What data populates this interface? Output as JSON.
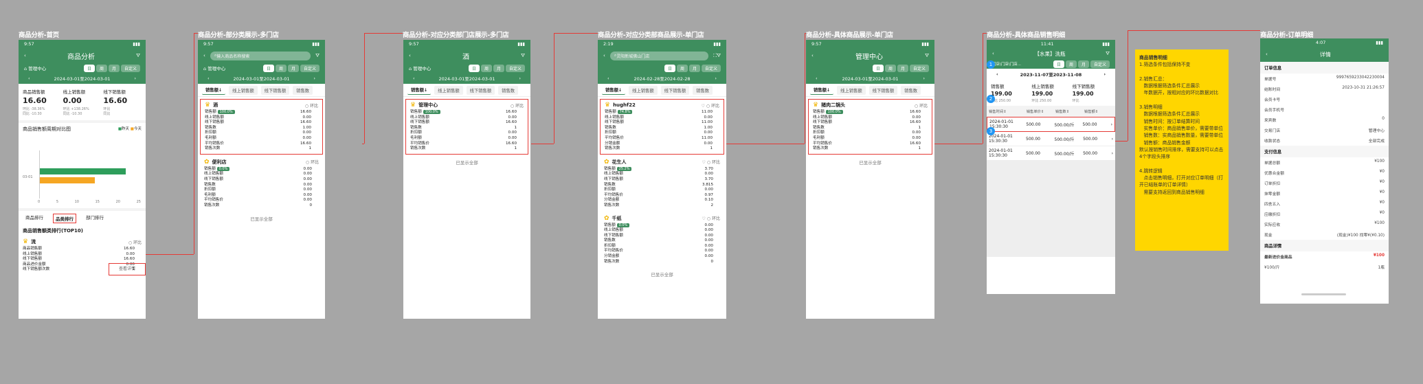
{
  "colors": {
    "brand": "#3e8e5e",
    "highlight": "#e53935",
    "note_bg": "#ffd600",
    "bar_green": "#2e9e5b",
    "bar_orange": "#f5a623"
  },
  "titles": [
    "商品分析-首页",
    "商品分析-部分类展示-多门店",
    "商品分析-对应分类部门店展示-多门店",
    "商品分析-对应分类部商品展示-单门店",
    "商品分析-具体商品展示-单门店",
    "商品分析-具体商品销售明细",
    "商品分析-订单明细"
  ],
  "s1": {
    "time": "9:57",
    "title": "商品分析",
    "store": "管理中心",
    "seg": [
      "日",
      "周",
      "月",
      "自定义"
    ],
    "range": "2024-03-01至2024-03-01",
    "kpis": [
      {
        "label": "商品销售额",
        "value": "16.60",
        "c1": "环比 -38.36%",
        "c2": "同比 -10.30"
      },
      {
        "label": "线上销售额",
        "value": "0.00",
        "c1": "环比 +138.26%",
        "c2": "同比 -10.30"
      },
      {
        "label": "线下销售额",
        "value": "16.60",
        "c1": "环比",
        "c2": "同比"
      }
    ],
    "chart_title": "商品销售额周期对比图",
    "legend": [
      "昨天",
      "今天"
    ],
    "ycat": "03-01",
    "xt": [
      "0",
      "5",
      "10",
      "15",
      "20",
      "25"
    ],
    "tabs": [
      "商品排行",
      "品类排行",
      "部门排行"
    ],
    "rank_title": "商品销售额类排行(TOP10)",
    "detail_btn": "查看详情",
    "item": "流",
    "compare": "环比",
    "rows": [
      [
        "商品销售额",
        "16.60"
      ],
      [
        "线上销售额",
        "0.00"
      ],
      [
        "线下销售额",
        "16.60"
      ],
      [
        "商品进价金额",
        "0.00"
      ],
      [
        "线下销售额次数",
        "1"
      ]
    ]
  },
  "s2": {
    "time": "9:57",
    "search": "输入商品名称搜索",
    "store": "管理中心",
    "range": "2024-03-01至2024-03-01",
    "ftabs": [
      "销售额↓",
      "线上销售额",
      "线下销售额",
      "销售数"
    ],
    "cards": [
      {
        "name": "酒",
        "pct": "100.0%",
        "compare": "环比",
        "rows": [
          [
            "销售额",
            "16.60"
          ],
          [
            "线上销售额",
            "0.00"
          ],
          [
            "线下销售额",
            "16.60"
          ],
          [
            "销售数",
            "1.00"
          ],
          [
            "折扣额",
            "0.00"
          ],
          [
            "毛利额",
            "0.00"
          ],
          [
            "平均销售价",
            "16.60"
          ],
          [
            "销售次数",
            "1"
          ]
        ]
      },
      {
        "name": "便利店",
        "pct": "0.0%",
        "compare": "环比",
        "rows": [
          [
            "销售额",
            "0.00"
          ],
          [
            "线上销售额",
            "0.00"
          ],
          [
            "线下销售额",
            "0.00"
          ],
          [
            "销售数",
            "0.00"
          ],
          [
            "折扣额",
            "0.00"
          ],
          [
            "毛利额",
            "0.00"
          ],
          [
            "平均销售价",
            "0.00"
          ],
          [
            "销售次数",
            "0"
          ]
        ]
      }
    ],
    "more": "已显示全部"
  },
  "s3": {
    "time": "9:57",
    "title": "酒",
    "store": "管理中心",
    "range": "2024-03-01至2024-03-01",
    "ftabs": [
      "销售额↓",
      "线上销售额",
      "线下销售额",
      "销售数"
    ],
    "cards": [
      {
        "name": "管理中心",
        "pct": "100.0%",
        "compare": "环比",
        "rows": [
          [
            "销售额",
            "16.60"
          ],
          [
            "线上销售额",
            "0.00"
          ],
          [
            "线下销售额",
            "16.60"
          ],
          [
            "销售数",
            "1"
          ],
          [
            "折扣额",
            "0.00"
          ],
          [
            "毛利额",
            "0.00"
          ],
          [
            "平均销售价",
            "16.60"
          ],
          [
            "销售次数",
            "1"
          ]
        ]
      }
    ],
    "more": "已显示全部"
  },
  "s4": {
    "time": "2:19",
    "search": "灵阳新城佛山门店",
    "range": "2024-02-28至2024-02-28",
    "ftabs": [
      "销售额↓",
      "线上销售额",
      "线下销售额",
      "销售数"
    ],
    "cards": [
      {
        "name": "hughf22",
        "pct": "74.8%",
        "compare": "环比",
        "rows": [
          [
            "销售额",
            "11.00"
          ],
          [
            "线上销售额",
            "0.00"
          ],
          [
            "线下销售额",
            "11.00"
          ],
          [
            "销售数",
            "1.00"
          ],
          [
            "折扣额",
            "0.00"
          ],
          [
            "平均销售价",
            "11.00"
          ],
          [
            "分销金额",
            "0.00"
          ],
          [
            "销售次数",
            "1"
          ]
        ]
      },
      {
        "name": "花生人",
        "pct": "25.2%",
        "compare": "环比",
        "rows": [
          [
            "销售额",
            "3.70"
          ],
          [
            "线上销售额",
            "0.00"
          ],
          [
            "线下销售额",
            "3.70"
          ],
          [
            "销售数",
            "3.815"
          ],
          [
            "折扣额",
            "0.00"
          ],
          [
            "平均销售价",
            "0.97"
          ],
          [
            "分销金额",
            "0.10"
          ],
          [
            "销售次数",
            "2"
          ]
        ]
      },
      {
        "name": "千纸",
        "pct": "0.0%",
        "compare": "环比",
        "rows": [
          [
            "销售额",
            "0.00"
          ],
          [
            "线上销售额",
            "0.00"
          ],
          [
            "线下销售额",
            "0.00"
          ],
          [
            "销售数",
            "0.00"
          ],
          [
            "折扣额",
            "0.00"
          ],
          [
            "平均销售价",
            "0.00"
          ],
          [
            "分销金额",
            "0.00"
          ],
          [
            "销售次数",
            "0"
          ]
        ]
      }
    ],
    "more": "已显示全部"
  },
  "s5": {
    "time": "9:57",
    "title": "管理中心",
    "range": "2024-03-01至2024-03-01",
    "ftabs": [
      "销售额↓",
      "线上销售额",
      "线下销售额",
      "销售数"
    ],
    "cards": [
      {
        "name": "猪肉二锅头",
        "pct": "100.0%",
        "compare": "环比",
        "rows": [
          [
            "销售额",
            "16.60"
          ],
          [
            "线上销售额",
            "0.00"
          ],
          [
            "线下销售额",
            "16.60"
          ],
          [
            "销售数",
            "1"
          ],
          [
            "折扣额",
            "0.00"
          ],
          [
            "毛利额",
            "0.00"
          ],
          [
            "平均销售价",
            "16.60"
          ],
          [
            "销售次数",
            "1"
          ]
        ]
      }
    ],
    "more": "已显示全部"
  },
  "s6": {
    "time": "11:41",
    "title": "【水果】洗瓶",
    "store": "门店\\门店\\门店...",
    "seg": [
      "日",
      "周",
      "月",
      "自定义"
    ],
    "range": "2023-11-07至2023-11-08",
    "kpis": [
      {
        "label": "销售额",
        "value": "199.00",
        "c": "环比 250.00"
      },
      {
        "label": "线上销售额",
        "value": "199.00",
        "c": "环比 250.00"
      },
      {
        "label": "线下销售额",
        "value": "199.00",
        "c": "环比"
      }
    ],
    "cols": [
      "销售时间⇕",
      "销售单价⇕",
      "销售数⇕",
      "销售额⇕"
    ],
    "rows": [
      [
        "2024-01-01 15:30:30",
        "500.00",
        "500.00/斤",
        "500.00"
      ],
      [
        "2024-01-01 15:30:30",
        "500.00",
        "500.00/斤",
        "500.00"
      ],
      [
        "2024-01-01 15:30:30",
        "500.00",
        "500.00/斤",
        "500.00"
      ]
    ],
    "markers": [
      "1",
      "2",
      "3"
    ]
  },
  "note": {
    "title": "商品销售明细",
    "lines": [
      "1.筛选条件包括保持不变",
      "",
      "2.销售汇总：",
      "   数据根据筛选条件汇总展示",
      "   年数据开，按相对应的环比数据对比",
      "",
      "3.销售明细",
      "   数据根据筛选条件汇总展示",
      "   销售时间：按订单结算时间",
      "   实售单价：商品销售单价，需要带单位",
      "   销售数：实商品销售数量，需要带单位",
      "   销售额：商品销售金额",
      "默认按销售时间排序，需要支持可以点击4个字段头排序",
      "",
      "4.跳转逻辑",
      "   点击销售明细，打开对应订单明细（打开已结账单的订单详情）",
      "   需要支持返回到商品销售明细"
    ]
  },
  "s7": {
    "time": "4:07",
    "title": "详情",
    "g1": {
      "h": "订单信息",
      "rows": [
        [
          "单据号",
          "9997659233042230004"
        ],
        [
          "结账时间",
          "2023-10-31 21:26:57"
        ],
        [
          "会员卡号",
          ""
        ],
        [
          "会员手机号",
          ""
        ],
        [
          "来宾数",
          "0"
        ],
        [
          "交易门店",
          "管理中心"
        ],
        [
          "收款状态",
          "全部完成"
        ]
      ]
    },
    "g2": {
      "h": "支付信息",
      "rows": [
        [
          "单据总额",
          "¥100"
        ],
        [
          "优惠合金额",
          "¥0"
        ],
        [
          "订单折扣",
          "¥0"
        ],
        [
          "抹零金额",
          "¥0"
        ],
        [
          "四舍五入",
          "¥0"
        ],
        [
          "应缴折扣",
          "¥0"
        ],
        [
          "实际应收",
          "¥100"
        ],
        [
          "现金",
          "(现金)¥100 找零¥(¥0.10)"
        ]
      ]
    },
    "g3": {
      "h": "商品详情",
      "rows": [
        [
          "最新进价金商品",
          "¥100"
        ],
        [
          "¥100/斤",
          "1瓶"
        ]
      ]
    }
  }
}
